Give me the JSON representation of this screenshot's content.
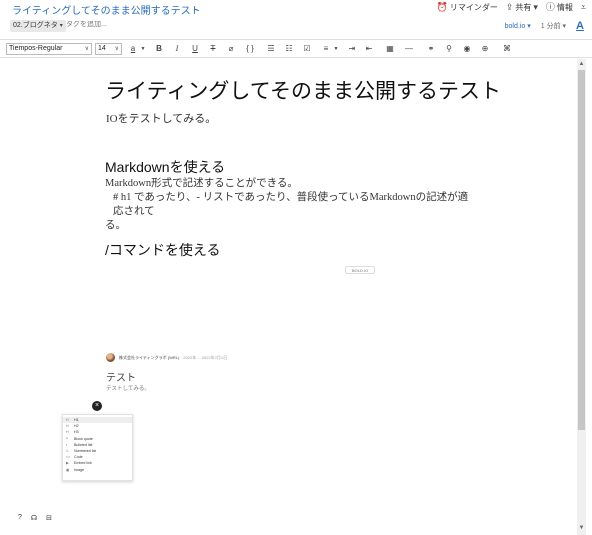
{
  "window": {
    "title": "ライティングしてそのまま公開するテスト",
    "actions": [
      {
        "label": "リマインダー",
        "icon": "alarm-clock-icon"
      },
      {
        "label": "共有",
        "icon": "share-icon"
      },
      {
        "label": "情報",
        "icon": "info-icon"
      }
    ]
  },
  "tag_row": {
    "notebook": "02.ブログネタ",
    "tag_placeholder": "タグを追加...",
    "site": "bold.io",
    "read_time": "1 分前",
    "font_button": "A"
  },
  "toolbar": {
    "font_family": "Tiempos-Regular",
    "font_size": "14",
    "buttons": [
      {
        "icon": "text-color-icon",
        "glyph": "a"
      },
      {
        "icon": "bold-icon",
        "glyph": "B"
      },
      {
        "icon": "italic-icon",
        "glyph": "I"
      },
      {
        "icon": "underline-icon",
        "glyph": "U"
      },
      {
        "icon": "strikethrough-icon",
        "glyph": "T"
      },
      {
        "icon": "highlight-icon",
        "glyph": "⌀"
      },
      {
        "icon": "code-icon",
        "glyph": "{ }"
      },
      {
        "icon": "bullet-list-icon",
        "glyph": "☰"
      },
      {
        "icon": "numbered-list-icon",
        "glyph": "☷"
      },
      {
        "icon": "checkbox-icon",
        "glyph": "☑"
      },
      {
        "icon": "align-icon",
        "glyph": "≡"
      },
      {
        "icon": "indent-icon",
        "glyph": "⇥"
      },
      {
        "icon": "outdent-icon",
        "glyph": "⇤"
      },
      {
        "icon": "table-icon",
        "glyph": "▦"
      },
      {
        "icon": "horizontal-rule-icon",
        "glyph": "—"
      },
      {
        "icon": "link-icon",
        "glyph": "⚭"
      },
      {
        "icon": "attachment-icon",
        "glyph": "⚲"
      },
      {
        "icon": "record-icon",
        "glyph": "◉"
      },
      {
        "icon": "encrypt-icon",
        "glyph": "⊕"
      },
      {
        "icon": "more-icon",
        "glyph": "⌘"
      }
    ]
  },
  "document": {
    "title": "ライティングしてそのまま公開するテスト",
    "lead": "IOをテストしてみる。",
    "section1": {
      "heading": "Markdownを使える",
      "line1": "Markdown形式で記述することができる。",
      "line2": "# h1 であったり、- リストであったり、普段使っているMarkdownの記述が適応されて",
      "line3": "る。"
    },
    "section2": {
      "heading": "/コマンドを使える"
    },
    "embed_badge": "BOLD.IO",
    "card": {
      "author": "株式会社ライティングラボ (WRL)",
      "date": "2022年 ... 2022年7月1日",
      "title": "テスト",
      "description": "テストしてみる。"
    }
  },
  "command_menu": {
    "close_glyph": "×",
    "items": [
      {
        "icon": "H",
        "label": "H1"
      },
      {
        "icon": "H",
        "label": "H2"
      },
      {
        "icon": "H",
        "label": "H3"
      },
      {
        "icon": "❝",
        "label": "Block quote"
      },
      {
        "icon": "•",
        "label": "Bulleted list"
      },
      {
        "icon": "1.",
        "label": "Numbered list"
      },
      {
        "icon": "<>",
        "label": "Code"
      },
      {
        "icon": "▶",
        "label": "Embed link"
      },
      {
        "icon": "▣",
        "label": "Image"
      }
    ]
  },
  "help_icons": [
    {
      "icon": "help-icon",
      "glyph": "?"
    },
    {
      "icon": "headphones-icon",
      "glyph": "☊"
    },
    {
      "icon": "gift-icon",
      "glyph": "⊟"
    }
  ]
}
